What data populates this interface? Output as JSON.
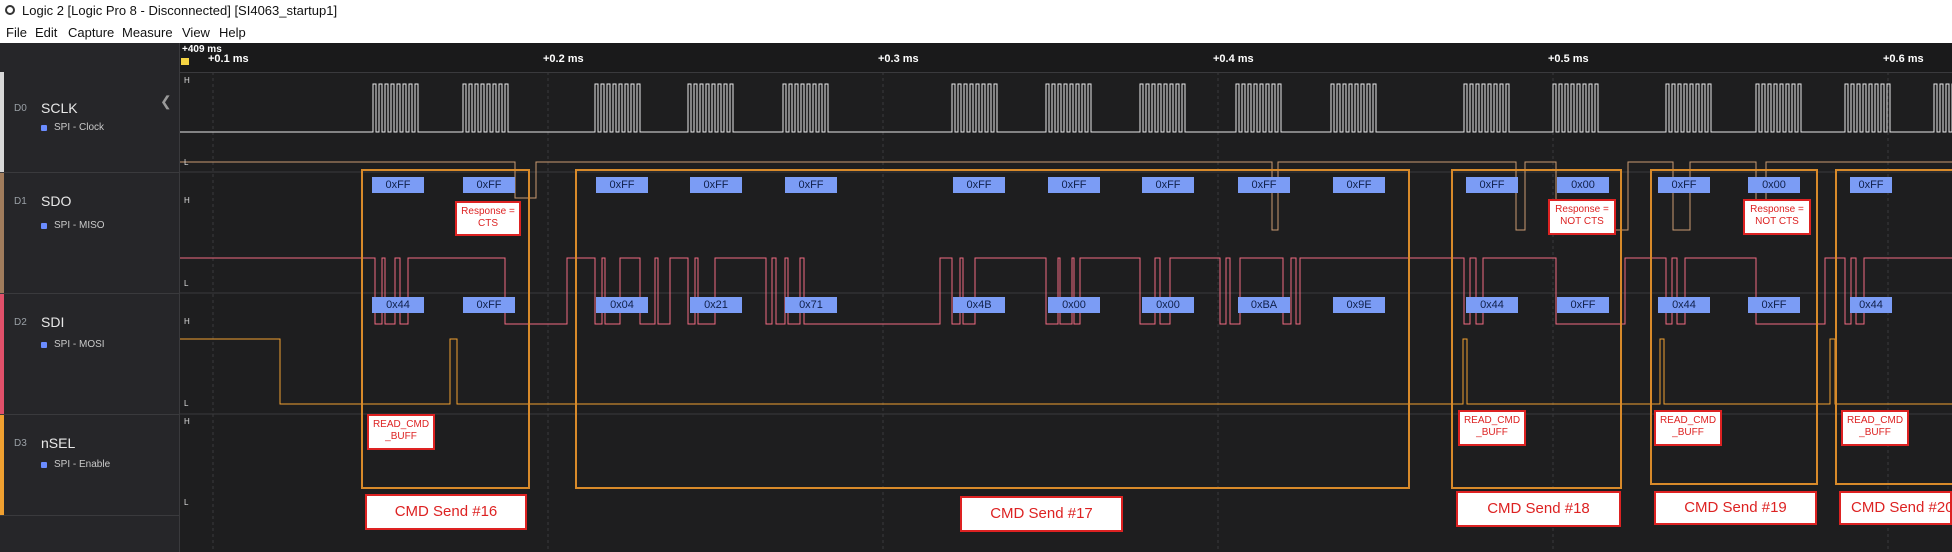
{
  "window": {
    "title": "Logic 2 [Logic Pro 8 - Disconnected] [SI4063_startup1]"
  },
  "menu": [
    "File",
    "Edit",
    "Capture",
    "Measure",
    "View",
    "Help"
  ],
  "ruler": {
    "origin_label": "+409 ms",
    "ticks": [
      "+0.1 ms",
      "+0.2 ms",
      "+0.3 ms",
      "+0.4 ms",
      "+0.5 ms",
      "+0.6 ms"
    ]
  },
  "level_labels": {
    "high": "H",
    "low": "L"
  },
  "channels": [
    {
      "index": "D0",
      "name": "SCLK",
      "sub": "SPI - Clock",
      "color": "#d8d8d8"
    },
    {
      "index": "D1",
      "name": "SDO",
      "sub": "SPI - MISO",
      "color": "#a07c5c"
    },
    {
      "index": "D2",
      "name": "SDI",
      "sub": "SPI - MOSI",
      "color": "#e0506a"
    },
    {
      "index": "D3",
      "name": "nSEL",
      "sub": "SPI - Enable",
      "color": "#f0a030"
    }
  ],
  "miso_bytes": [
    "0xFF",
    "0xFF",
    "0xFF",
    "0xFF",
    "0xFF",
    "0xFF",
    "0xFF",
    "0xFF",
    "0xFF",
    "0xFF",
    "0xFF",
    "0x00",
    "0xFF",
    "0x00",
    "0xFF"
  ],
  "mosi_bytes": [
    "0x44",
    "0xFF",
    "0x04",
    "0x21",
    "0x71",
    "0x4B",
    "0x00",
    "0x00",
    "0xBA",
    "0x9E",
    "0x44",
    "0xFF",
    "0x44",
    "0xFF",
    "0x44"
  ],
  "response_notes": [
    "Response =\nCTS",
    "Response =\nNOT CTS",
    "Response =\nNOT CTS"
  ],
  "read_notes": [
    "READ_CMD\n_BUFF",
    "READ_CMD\n_BUFF",
    "READ_CMD\n_BUFF",
    "READ_CMD\n_BUFF"
  ],
  "cmd_labels": [
    "CMD Send #16",
    "CMD Send #17",
    "CMD Send #18",
    "CMD Send #19",
    "CMD Send #20"
  ],
  "colors": {
    "background": "#1e1e1f",
    "annotation_frame": "#d88a2a",
    "annotation_red": "#dd2222",
    "byte_badge": "#7b9cf5"
  }
}
